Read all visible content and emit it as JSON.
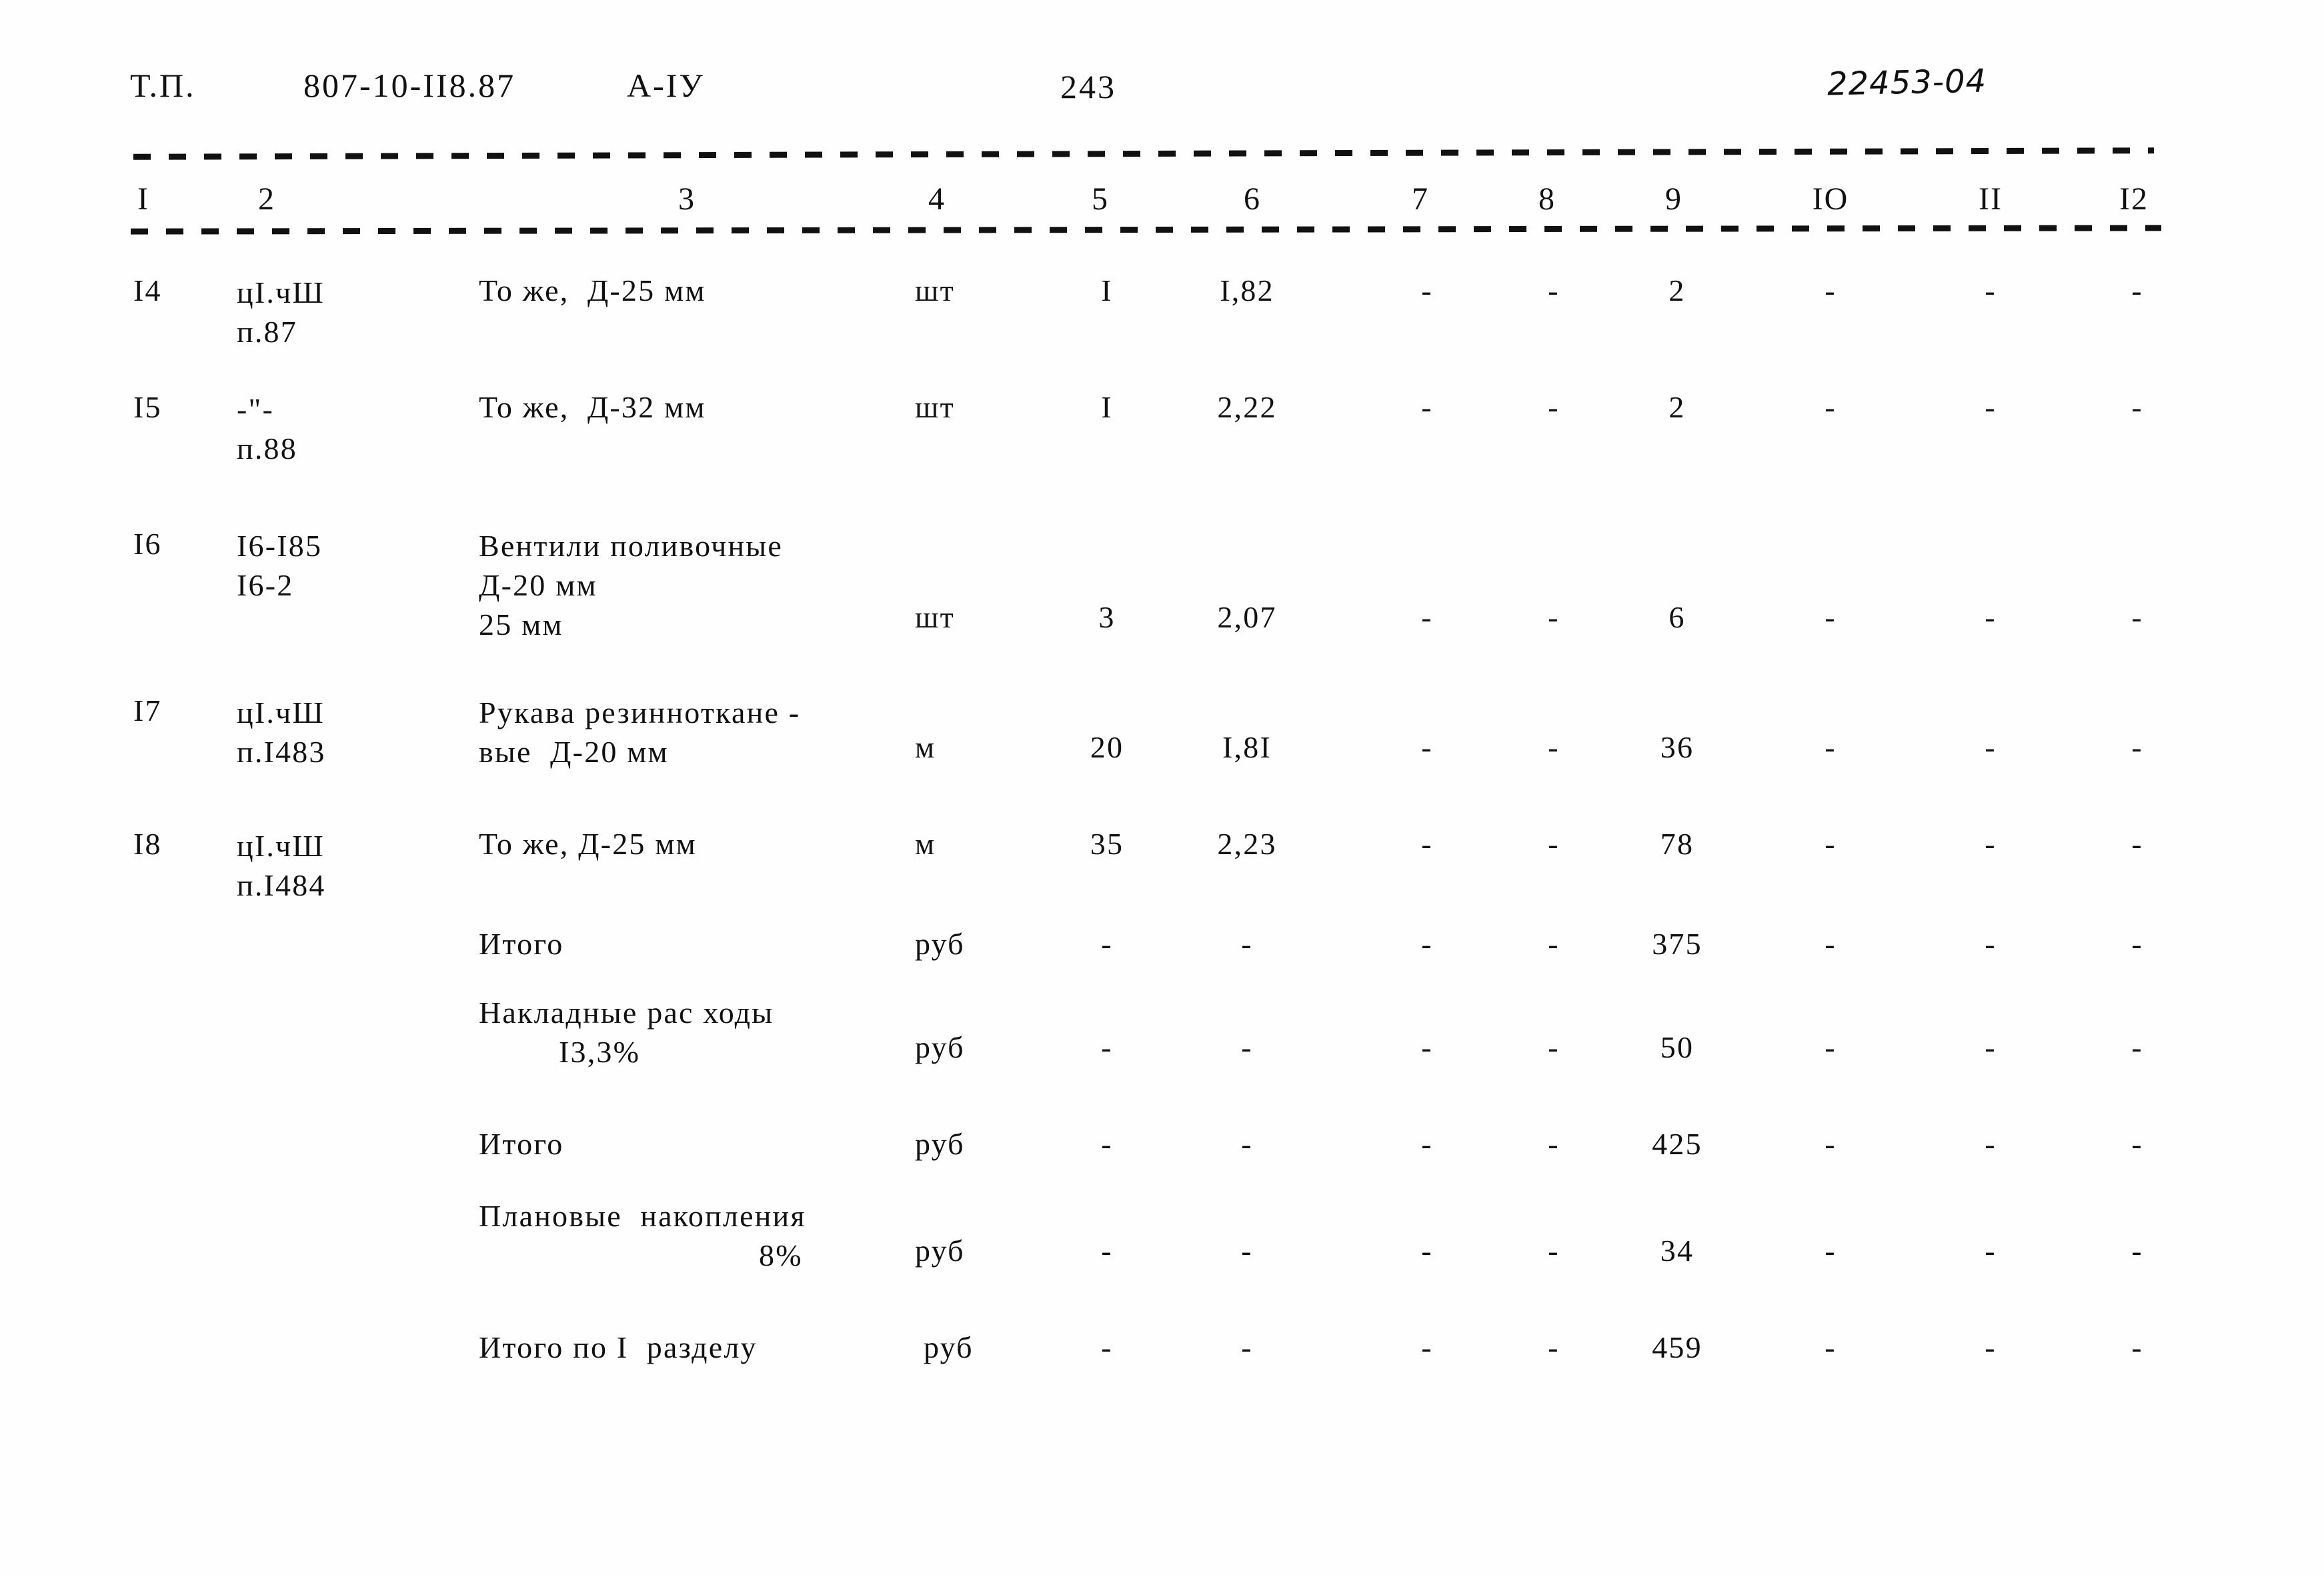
{
  "header": {
    "doc_label": "Т.П.",
    "series": "807-10-II8.87",
    "album": "А-IУ",
    "page_number": "243",
    "archive_code": "22453-04"
  },
  "table": {
    "column_headers": [
      "I",
      "2",
      "3",
      "4",
      "5",
      "6",
      "7",
      "8",
      "9",
      "IO",
      "II",
      "I2"
    ],
    "rows": [
      {
        "num": "I4",
        "code_line1": "цI.чШ",
        "code_line2": "п.87",
        "desc_line1": "То же,  Д-25 мм",
        "desc_line2": "",
        "desc_line3": "",
        "unit": "шт",
        "qty": "I",
        "price": "I,82",
        "c7": "-",
        "c8": "-",
        "c9": "2",
        "c10": "-",
        "c11": "-",
        "c12": "-"
      },
      {
        "num": "I5",
        "code_line1": "-\"-",
        "code_line2": "п.88",
        "desc_line1": "То же,  Д-32 мм",
        "desc_line2": "",
        "desc_line3": "",
        "unit": "шт",
        "qty": "I",
        "price": "2,22",
        "c7": "-",
        "c8": "-",
        "c9": "2",
        "c10": "-",
        "c11": "-",
        "c12": "-"
      },
      {
        "num": "I6",
        "code_line1": "I6-I85",
        "code_line2": "I6-2",
        "desc_line1": "Вентили поливочные",
        "desc_line2": "Д-20 мм",
        "desc_line3": "25 мм",
        "unit": "шт",
        "qty": "3",
        "price": "2,07",
        "c7": "-",
        "c8": "-",
        "c9": "6",
        "c10": "-",
        "c11": "-",
        "c12": "-"
      },
      {
        "num": "I7",
        "code_line1": "цI.чШ",
        "code_line2": "п.I483",
        "desc_line1": "Рукава резинноткане -",
        "desc_line2": "вые  Д-20 мм",
        "desc_line3": "",
        "unit": "м",
        "qty": "20",
        "price": "I,8I",
        "c7": "-",
        "c8": "-",
        "c9": "36",
        "c10": "-",
        "c11": "-",
        "c12": "-"
      },
      {
        "num": "I8",
        "code_line1": "цI.чШ",
        "code_line2": "п.I484",
        "desc_line1": "То же, Д-25 мм",
        "desc_line2": "",
        "desc_line3": "",
        "unit": "м",
        "qty": "35",
        "price": "2,23",
        "c7": "-",
        "c8": "-",
        "c9": "78",
        "c10": "-",
        "c11": "-",
        "c12": "-"
      }
    ],
    "summary_rows": [
      {
        "num": "",
        "code_line1": "",
        "code_line2": "",
        "desc_line1": "Итого",
        "desc_line2": "",
        "desc_line3": "",
        "unit": "руб",
        "qty": "-",
        "price": "-",
        "c7": "-",
        "c8": "-",
        "c9": "375",
        "c10": "-",
        "c11": "-",
        "c12": "-"
      },
      {
        "num": "",
        "code_line1": "",
        "code_line2": "",
        "desc_line1": "Накладные рас ходы",
        "desc_line2": "I3,3%",
        "desc_line3": "",
        "unit": "руб",
        "qty": "-",
        "price": "-",
        "c7": "-",
        "c8": "-",
        "c9": "50",
        "c10": "-",
        "c11": "-",
        "c12": "-"
      },
      {
        "num": "",
        "code_line1": "",
        "code_line2": "",
        "desc_line1": "Итого",
        "desc_line2": "",
        "desc_line3": "",
        "unit": "руб",
        "qty": "-",
        "price": "-",
        "c7": "-",
        "c8": "-",
        "c9": "425",
        "c10": "-",
        "c11": "-",
        "c12": "-"
      },
      {
        "num": "",
        "code_line1": "",
        "code_line2": "",
        "desc_line1": "Плановые  накопления",
        "desc_line2": "8%",
        "desc_line3": "",
        "unit": "руб",
        "qty": "-",
        "price": "-",
        "c7": "-",
        "c8": "-",
        "c9": "34",
        "c10": "-",
        "c11": "-",
        "c12": "-"
      },
      {
        "num": "",
        "code_line1": "",
        "code_line2": "",
        "desc_line1": "Итого по I  разделу",
        "desc_line2": "",
        "desc_line3": "",
        "unit": "руб",
        "qty": "-",
        "price": "-",
        "c7": "-",
        "c8": "-",
        "c9": "459",
        "c10": "-",
        "c11": "-",
        "c12": "-"
      }
    ]
  }
}
